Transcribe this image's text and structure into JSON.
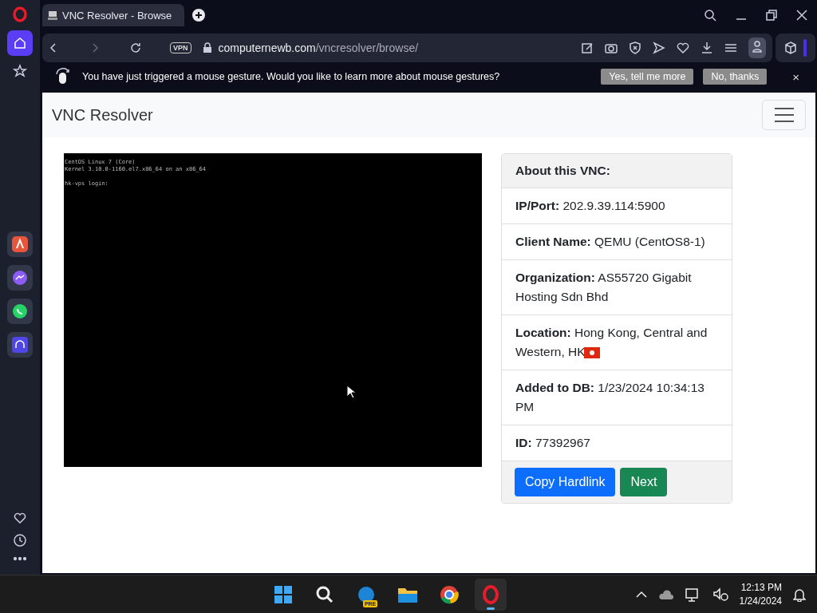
{
  "browser": {
    "tab": {
      "title": "VNC Resolver - Browse",
      "selected": true
    },
    "address": {
      "vpn": "VPN",
      "domain": "computernewb.com",
      "path": "/vncresolver/browse/"
    },
    "gesture_bar": {
      "message": "You have just triggered a mouse gesture. Would you like to learn more about mouse gestures?",
      "buttons": [
        "Yes, tell me more",
        "No, thanks"
      ],
      "close": "×"
    }
  },
  "page": {
    "brand": "VNC Resolver",
    "console_lines": [
      "CentOS Linux 7 (Core)",
      "Kernel 3.10.0-1160.el7.x86_64 on an x86_64",
      "hk-vps login:"
    ],
    "card": {
      "title": "About this VNC:",
      "rows": [
        {
          "text": "**IP/Port:** 202.9.39.114:5900",
          "flag": false
        },
        {
          "text": "**Client Name:** QEMU (CentOS8-1)",
          "flag": false
        },
        {
          "text": "**Organization:** AS55720 Gigabit Hosting Sdn Bhd",
          "flag": false
        },
        {
          "text": "**Location:** Hong Kong, Central and Western, HK",
          "flag": true
        },
        {
          "text": "**Added to DB:** 1/23/2024 10:34:13 PM",
          "flag": false
        },
        {
          "text": "**ID:** 77392967",
          "flag": false
        }
      ],
      "buttons": [
        {
          "label": "Copy Hardlink",
          "kind": "primary"
        },
        {
          "label": "Next",
          "kind": "success"
        }
      ]
    }
  },
  "taskbar": {
    "edge_badge": "PRE",
    "time": "12:13 PM",
    "date": "1/24/2024"
  }
}
